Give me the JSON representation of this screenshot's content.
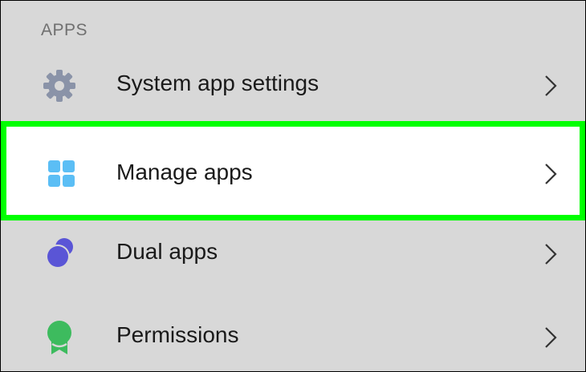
{
  "section": {
    "title": "APPS"
  },
  "items": [
    {
      "label": "System app settings",
      "icon": "gear-icon",
      "icon_color": "#8a93a8",
      "highlighted": false
    },
    {
      "label": "Manage apps",
      "icon": "grid-icon",
      "icon_color": "#5bbef5",
      "highlighted": true
    },
    {
      "label": "Dual apps",
      "icon": "dual-apps-icon",
      "icon_color": "#5a55d6",
      "highlighted": false
    },
    {
      "label": "Permissions",
      "icon": "ribbon-badge-icon",
      "icon_color": "#3dbb5e",
      "highlighted": false
    }
  ],
  "colors": {
    "background": "#d8d8d8",
    "highlight_border": "#00ff00",
    "highlight_fill": "#ffffff"
  }
}
